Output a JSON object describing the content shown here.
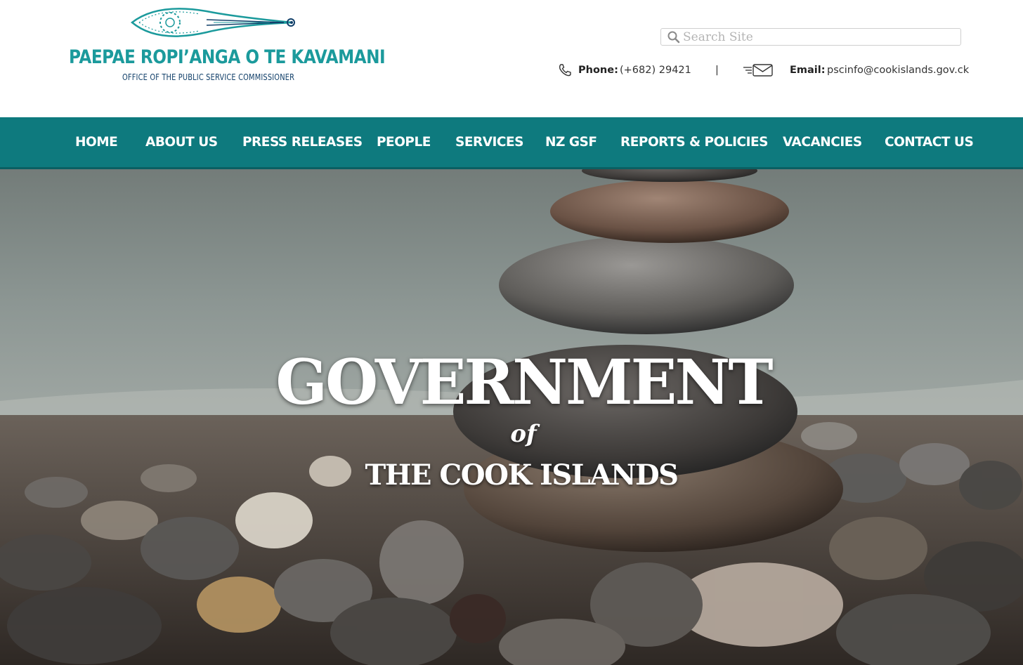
{
  "header": {
    "logo_title": "PAEPAE ROPI’ANGA O TE KAVAMANI",
    "logo_subtitle": "OFFICE OF THE  PUBLIC SERVICE COMMISSIONER",
    "search_placeholder": "Search Site",
    "phone_label": "Phone:",
    "phone_value": "(+682) 29421",
    "separator": "|",
    "email_label": "Email:",
    "email_value": "pscinfo@cookislands.gov.ck"
  },
  "nav": {
    "items": [
      {
        "label": "HOME"
      },
      {
        "label": "ABOUT US"
      },
      {
        "label": "PRESS RELEASES"
      },
      {
        "label": "PEOPLE"
      },
      {
        "label": "SERVICES"
      },
      {
        "label": "NZ GSF"
      },
      {
        "label": "REPORTS & POLICIES"
      },
      {
        "label": "VACANCIES"
      },
      {
        "label": "CONTACT US"
      }
    ]
  },
  "hero": {
    "title": "GOVERNMENT",
    "connector": "of",
    "subtitle": "THE COOK ISLANDS"
  },
  "colors": {
    "brand_teal": "#1b9a9c",
    "nav_bg": "#0e7a7e",
    "logo_subtitle": "#12406a"
  },
  "icons": [
    "logo-canoe-mark",
    "search-icon",
    "phone-icon",
    "mail-icon"
  ]
}
